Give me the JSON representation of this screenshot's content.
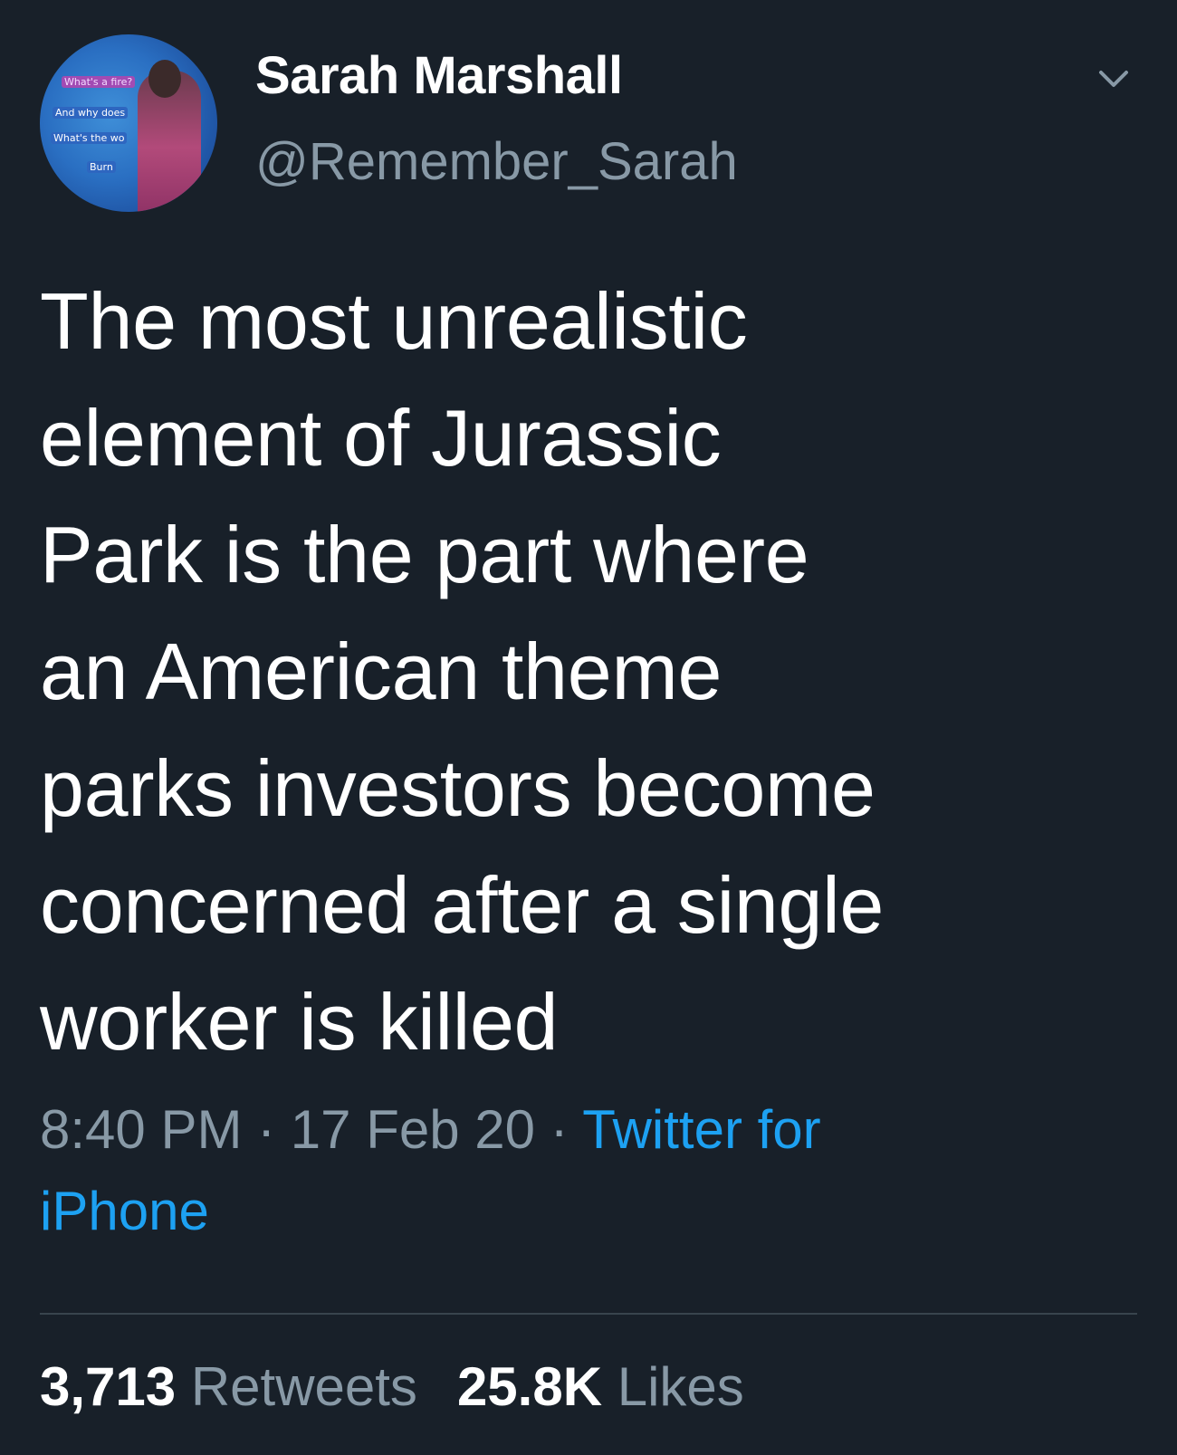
{
  "user": {
    "display_name": "Sarah Marshall",
    "handle": "@Remember_Sarah",
    "avatar_captions": [
      "What's a fire?",
      "And why does",
      "What's the wo",
      "Burn"
    ]
  },
  "tweet": {
    "text": "The most unrealistic\nelement of Jurassic\nPark is the part where\nan American theme\nparks investors become\nconcerned after a single\nworker is killed",
    "time": "8:40 PM",
    "separator": "·",
    "date": "17 Feb 20",
    "source": "Twitter for iPhone"
  },
  "stats": {
    "retweets_count": "3,713",
    "retweets_label": "Retweets",
    "likes_count": "25.8K",
    "likes_label": "Likes"
  },
  "colors": {
    "background": "#182029",
    "primary_text": "#ffffff",
    "secondary_text": "#8899a6",
    "link": "#1da1f2",
    "divider": "#38444d"
  },
  "icons": {
    "menu": "chevron-down-icon"
  }
}
